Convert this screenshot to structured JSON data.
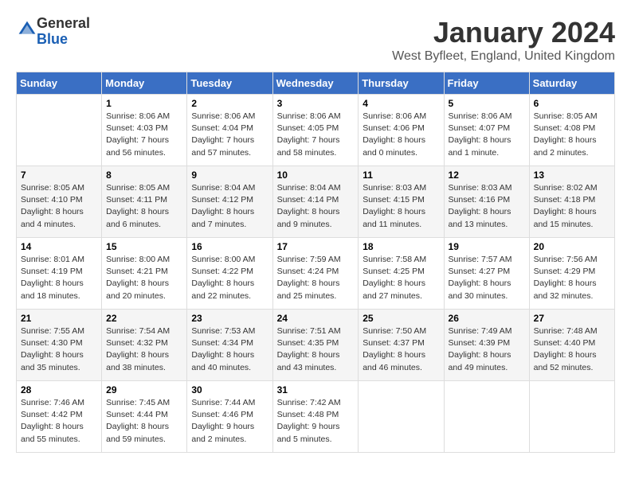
{
  "logo": {
    "general": "General",
    "blue": "Blue"
  },
  "header": {
    "month_title": "January 2024",
    "location": "West Byfleet, England, United Kingdom"
  },
  "weekdays": [
    "Sunday",
    "Monday",
    "Tuesday",
    "Wednesday",
    "Thursday",
    "Friday",
    "Saturday"
  ],
  "weeks": [
    [
      {
        "day": "",
        "sunrise": "",
        "sunset": "",
        "daylight": ""
      },
      {
        "day": "1",
        "sunrise": "8:06 AM",
        "sunset": "4:03 PM",
        "daylight": "7 hours and 56 minutes."
      },
      {
        "day": "2",
        "sunrise": "8:06 AM",
        "sunset": "4:04 PM",
        "daylight": "7 hours and 57 minutes."
      },
      {
        "day": "3",
        "sunrise": "8:06 AM",
        "sunset": "4:05 PM",
        "daylight": "7 hours and 58 minutes."
      },
      {
        "day": "4",
        "sunrise": "8:06 AM",
        "sunset": "4:06 PM",
        "daylight": "8 hours and 0 minutes."
      },
      {
        "day": "5",
        "sunrise": "8:06 AM",
        "sunset": "4:07 PM",
        "daylight": "8 hours and 1 minute."
      },
      {
        "day": "6",
        "sunrise": "8:05 AM",
        "sunset": "4:08 PM",
        "daylight": "8 hours and 2 minutes."
      }
    ],
    [
      {
        "day": "7",
        "sunrise": "8:05 AM",
        "sunset": "4:10 PM",
        "daylight": "8 hours and 4 minutes."
      },
      {
        "day": "8",
        "sunrise": "8:05 AM",
        "sunset": "4:11 PM",
        "daylight": "8 hours and 6 minutes."
      },
      {
        "day": "9",
        "sunrise": "8:04 AM",
        "sunset": "4:12 PM",
        "daylight": "8 hours and 7 minutes."
      },
      {
        "day": "10",
        "sunrise": "8:04 AM",
        "sunset": "4:14 PM",
        "daylight": "8 hours and 9 minutes."
      },
      {
        "day": "11",
        "sunrise": "8:03 AM",
        "sunset": "4:15 PM",
        "daylight": "8 hours and 11 minutes."
      },
      {
        "day": "12",
        "sunrise": "8:03 AM",
        "sunset": "4:16 PM",
        "daylight": "8 hours and 13 minutes."
      },
      {
        "day": "13",
        "sunrise": "8:02 AM",
        "sunset": "4:18 PM",
        "daylight": "8 hours and 15 minutes."
      }
    ],
    [
      {
        "day": "14",
        "sunrise": "8:01 AM",
        "sunset": "4:19 PM",
        "daylight": "8 hours and 18 minutes."
      },
      {
        "day": "15",
        "sunrise": "8:00 AM",
        "sunset": "4:21 PM",
        "daylight": "8 hours and 20 minutes."
      },
      {
        "day": "16",
        "sunrise": "8:00 AM",
        "sunset": "4:22 PM",
        "daylight": "8 hours and 22 minutes."
      },
      {
        "day": "17",
        "sunrise": "7:59 AM",
        "sunset": "4:24 PM",
        "daylight": "8 hours and 25 minutes."
      },
      {
        "day": "18",
        "sunrise": "7:58 AM",
        "sunset": "4:25 PM",
        "daylight": "8 hours and 27 minutes."
      },
      {
        "day": "19",
        "sunrise": "7:57 AM",
        "sunset": "4:27 PM",
        "daylight": "8 hours and 30 minutes."
      },
      {
        "day": "20",
        "sunrise": "7:56 AM",
        "sunset": "4:29 PM",
        "daylight": "8 hours and 32 minutes."
      }
    ],
    [
      {
        "day": "21",
        "sunrise": "7:55 AM",
        "sunset": "4:30 PM",
        "daylight": "8 hours and 35 minutes."
      },
      {
        "day": "22",
        "sunrise": "7:54 AM",
        "sunset": "4:32 PM",
        "daylight": "8 hours and 38 minutes."
      },
      {
        "day": "23",
        "sunrise": "7:53 AM",
        "sunset": "4:34 PM",
        "daylight": "8 hours and 40 minutes."
      },
      {
        "day": "24",
        "sunrise": "7:51 AM",
        "sunset": "4:35 PM",
        "daylight": "8 hours and 43 minutes."
      },
      {
        "day": "25",
        "sunrise": "7:50 AM",
        "sunset": "4:37 PM",
        "daylight": "8 hours and 46 minutes."
      },
      {
        "day": "26",
        "sunrise": "7:49 AM",
        "sunset": "4:39 PM",
        "daylight": "8 hours and 49 minutes."
      },
      {
        "day": "27",
        "sunrise": "7:48 AM",
        "sunset": "4:40 PM",
        "daylight": "8 hours and 52 minutes."
      }
    ],
    [
      {
        "day": "28",
        "sunrise": "7:46 AM",
        "sunset": "4:42 PM",
        "daylight": "8 hours and 55 minutes."
      },
      {
        "day": "29",
        "sunrise": "7:45 AM",
        "sunset": "4:44 PM",
        "daylight": "8 hours and 59 minutes."
      },
      {
        "day": "30",
        "sunrise": "7:44 AM",
        "sunset": "4:46 PM",
        "daylight": "9 hours and 2 minutes."
      },
      {
        "day": "31",
        "sunrise": "7:42 AM",
        "sunset": "4:48 PM",
        "daylight": "9 hours and 5 minutes."
      },
      {
        "day": "",
        "sunrise": "",
        "sunset": "",
        "daylight": ""
      },
      {
        "day": "",
        "sunrise": "",
        "sunset": "",
        "daylight": ""
      },
      {
        "day": "",
        "sunrise": "",
        "sunset": "",
        "daylight": ""
      }
    ]
  ]
}
